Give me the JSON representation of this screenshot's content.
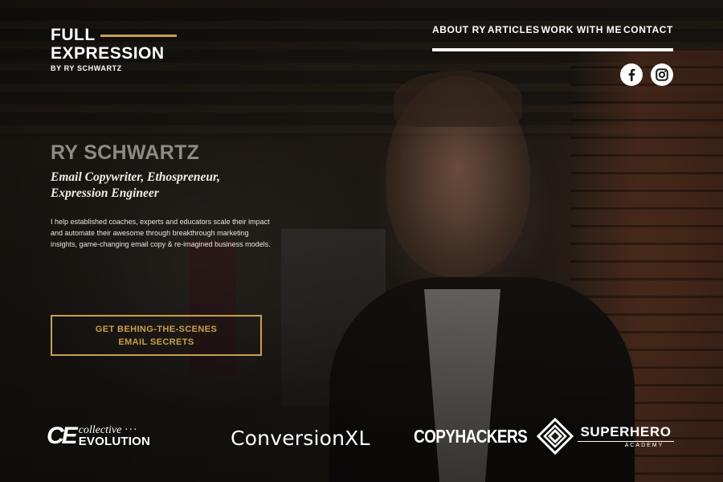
{
  "logo": {
    "line1": "FULL",
    "line2": "EXPRESSION",
    "byline": "BY RY SCHWARTZ",
    "accent_color": "#c8a04e"
  },
  "nav": {
    "items": [
      {
        "label": "ABOUT RY"
      },
      {
        "label": "ARTICLES"
      },
      {
        "label": "WORK WITH ME"
      },
      {
        "label": "CONTACT"
      }
    ]
  },
  "social": {
    "facebook_icon": "facebook-icon",
    "instagram_icon": "instagram-icon"
  },
  "hero": {
    "name": "RY SCHWARTZ",
    "role_line1": "Email Copywriter, Ethospreneur,",
    "role_line2": "Expression Engineer",
    "description": "I help established coaches, experts and educators scale their impact and automate their awesome through breakthrough marketing insights, game-changing email copy & re-imagined business models.",
    "cta_line1": "GET BEHING-THE-SCENES",
    "cta_line2": "EMAIL SECRETS",
    "cta_color": "#c8a04e"
  },
  "press": {
    "collective_evolution": {
      "mark": "CE",
      "top": "collective",
      "dots": "···",
      "bottom": "EVOLUTION"
    },
    "conversionxl": "ConversionXL",
    "copyhackers": "COPYHACKERS",
    "superhero": {
      "top": "SUPERHERO",
      "bottom": "ACADEMY"
    }
  }
}
